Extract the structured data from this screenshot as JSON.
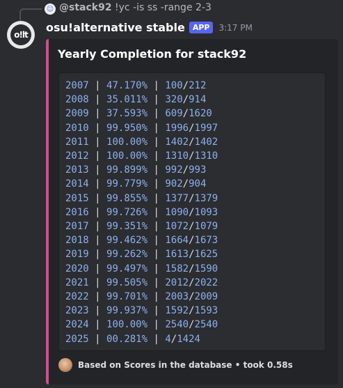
{
  "reply": {
    "author": "@stack92",
    "content": "!yc -is ss -range 2-3",
    "avatar_icon": "discord-clyde-icon"
  },
  "message": {
    "avatar_text": "o!lt",
    "username": "osu!alternative stable",
    "badge": "APP",
    "timestamp": "3:17 PM"
  },
  "embed": {
    "accent_color": "#d64b8f",
    "title": "Yearly Completion for stack92",
    "rows": [
      {
        "year": "2007",
        "percent": "47.170%",
        "done": "100",
        "total": "212"
      },
      {
        "year": "2008",
        "percent": "35.011%",
        "done": "320",
        "total": "914"
      },
      {
        "year": "2009",
        "percent": "37.593%",
        "done": "609",
        "total": "1620"
      },
      {
        "year": "2010",
        "percent": "99.950%",
        "done": "1996",
        "total": "1997"
      },
      {
        "year": "2011",
        "percent": "100.00%",
        "done": "1402",
        "total": "1402"
      },
      {
        "year": "2012",
        "percent": "100.00%",
        "done": "1310",
        "total": "1310"
      },
      {
        "year": "2013",
        "percent": "99.899%",
        "done": "992",
        "total": "993"
      },
      {
        "year": "2014",
        "percent": "99.779%",
        "done": "902",
        "total": "904"
      },
      {
        "year": "2015",
        "percent": "99.855%",
        "done": "1377",
        "total": "1379"
      },
      {
        "year": "2016",
        "percent": "99.726%",
        "done": "1090",
        "total": "1093"
      },
      {
        "year": "2017",
        "percent": "99.351%",
        "done": "1072",
        "total": "1079"
      },
      {
        "year": "2018",
        "percent": "99.462%",
        "done": "1664",
        "total": "1673"
      },
      {
        "year": "2019",
        "percent": "99.262%",
        "done": "1613",
        "total": "1625"
      },
      {
        "year": "2020",
        "percent": "99.497%",
        "done": "1582",
        "total": "1590"
      },
      {
        "year": "2021",
        "percent": "99.505%",
        "done": "2012",
        "total": "2022"
      },
      {
        "year": "2022",
        "percent": "99.701%",
        "done": "2003",
        "total": "2009"
      },
      {
        "year": "2023",
        "percent": "99.937%",
        "done": "1592",
        "total": "1593"
      },
      {
        "year": "2024",
        "percent": "100.00%",
        "done": "2540",
        "total": "2540"
      },
      {
        "year": "2025",
        "percent": "00.281%",
        "done": "4",
        "total": "1424"
      }
    ],
    "footer_text": "Based on Scores in the database • took 0.58s",
    "footer_icon": "user-avatar-icon"
  }
}
